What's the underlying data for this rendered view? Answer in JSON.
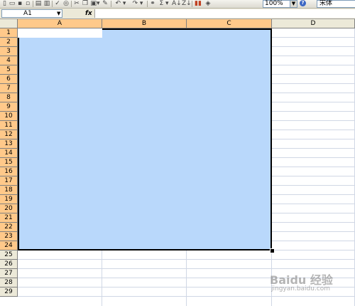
{
  "toolbar": {
    "icons": [
      "new-icon",
      "open-icon",
      "save-icon",
      "permission-icon",
      "print-icon",
      "print-preview-icon",
      "spelling-icon",
      "research-icon",
      "cut-icon",
      "copy-icon",
      "paste-icon",
      "format-painter-icon",
      "undo-icon",
      "redo-icon",
      "hyperlink-icon",
      "autosum-icon",
      "sort-ascending-icon",
      "sort-descending-icon",
      "chart-wizard-icon",
      "drawing-icon"
    ],
    "zoom_value": "100%",
    "font_name": "宋体"
  },
  "formula_bar": {
    "name_box_value": "A1",
    "fx_label": "fx",
    "formula_value": ""
  },
  "sheet": {
    "columns": [
      "A",
      "B",
      "C",
      "D"
    ],
    "rows": [
      "1",
      "2",
      "3",
      "4",
      "5",
      "6",
      "7",
      "8",
      "9",
      "10",
      "11",
      "12",
      "13",
      "14",
      "15",
      "16",
      "17",
      "18",
      "19",
      "20",
      "21",
      "22",
      "23",
      "24",
      "25",
      "26",
      "27",
      "28",
      "29"
    ],
    "selected_range": "A1:C24",
    "active_cell": "A1",
    "colors": {
      "selection_fill": "#b9d8fb",
      "selected_header": "#ffc98a",
      "header": "#ece9d8",
      "gridline": "#d0d7e5"
    }
  },
  "watermark": {
    "brand": "Baidu 经验",
    "url": "jingyan.baidu.com"
  }
}
